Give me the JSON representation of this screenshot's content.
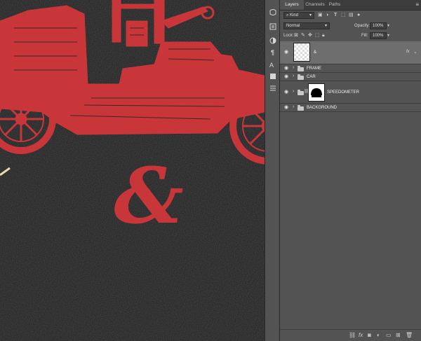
{
  "canvas": {
    "illustration": "red vintage car engraving with ampersand on black grunge background",
    "art_color": "#c8363a",
    "background_color": "#262626",
    "ampersand": "&"
  },
  "toolstrip": {
    "tools": [
      "history-icon",
      "properties-icon",
      "adjustments-icon",
      "character-icon",
      "paragraph-icon",
      "styles-icon",
      "align-icon"
    ]
  },
  "panel": {
    "tabs": [
      {
        "label": "Layers",
        "active": true
      },
      {
        "label": "Channels",
        "active": false
      },
      {
        "label": "Paths",
        "active": false
      }
    ],
    "filter_kind": "Kind",
    "blend_mode": "Normal",
    "opacity_label": "Opacity:",
    "opacity_value": "100%",
    "lock_label": "Lock:",
    "fill_label": "Fill:",
    "fill_value": "100%",
    "layers": [
      {
        "name": "&",
        "type": "text",
        "fx": "fx",
        "selected": true
      },
      {
        "name": "FRAME",
        "type": "group"
      },
      {
        "name": "CAR",
        "type": "group"
      },
      {
        "name": "SPEEDOMETER",
        "type": "masked-layer"
      },
      {
        "name": "BACKGROUND",
        "type": "group"
      }
    ],
    "bottom_icons": [
      "link-icon",
      "fx-icon",
      "mask-icon",
      "adjustment-icon",
      "folder-icon",
      "new-layer-icon",
      "trash-icon"
    ],
    "fx_label": "fx"
  }
}
